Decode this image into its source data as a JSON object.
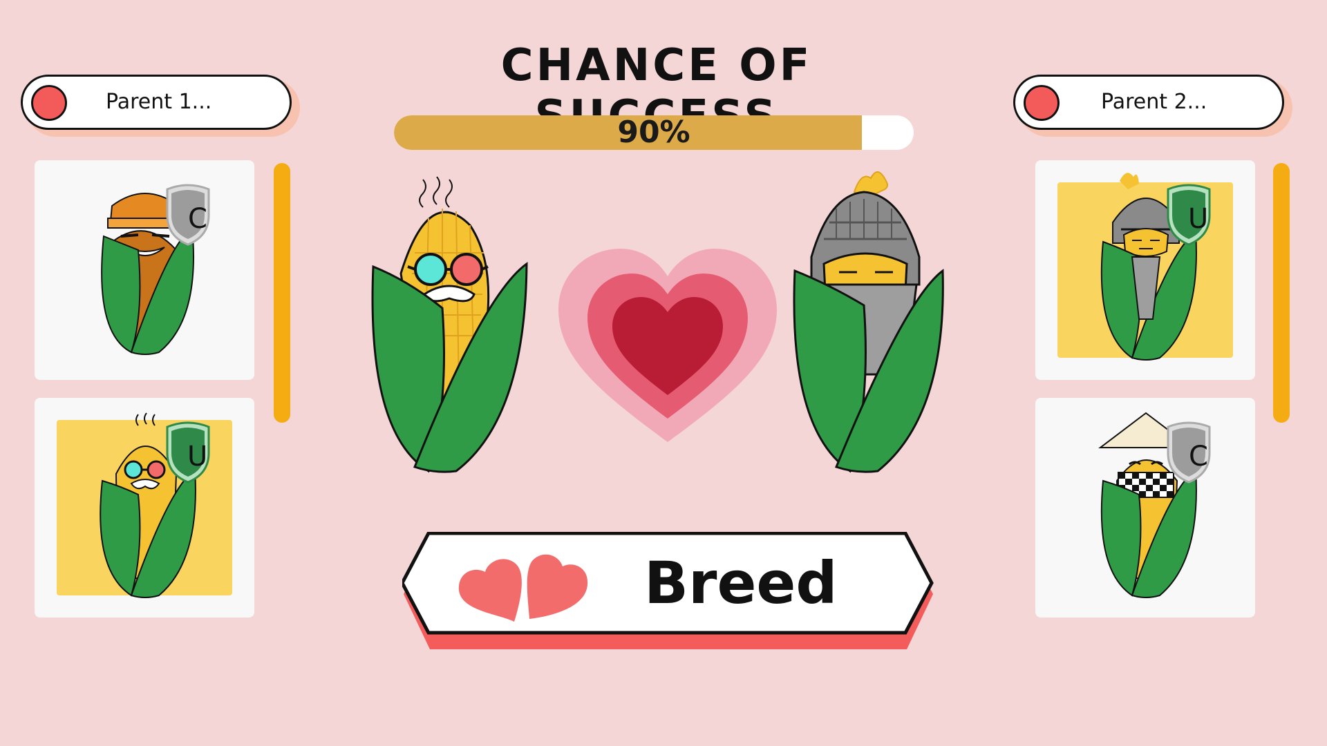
{
  "title": "CHANCE OF SUCCESS",
  "progress": {
    "label": "90%",
    "value": 0.9,
    "fill_color": "#dcaa48"
  },
  "parent1": {
    "label": "Parent 1...",
    "cards": [
      {
        "character": "miner-corn",
        "rarity": "C",
        "selected": false
      },
      {
        "character": "professor-corn",
        "rarity": "U",
        "selected": true
      }
    ]
  },
  "parent2": {
    "label": "Parent 2...",
    "cards": [
      {
        "character": "knight-corn",
        "rarity": "U",
        "selected": true
      },
      {
        "character": "straw-hat-corn",
        "rarity": "C",
        "selected": false
      }
    ]
  },
  "center": {
    "left_character": "professor-corn",
    "right_character": "knight-corn",
    "icon": "heart-icon"
  },
  "breed_button": {
    "label": "Breed",
    "icon": "hearts-icon"
  },
  "colors": {
    "background": "#f5d6d6",
    "accent_red": "#f35a5a",
    "scrollbar": "#f5ac13",
    "selected_card": "#f9d45e",
    "common_badge": "#9c9c9c",
    "uncommon_badge": "#2f8a4a"
  }
}
